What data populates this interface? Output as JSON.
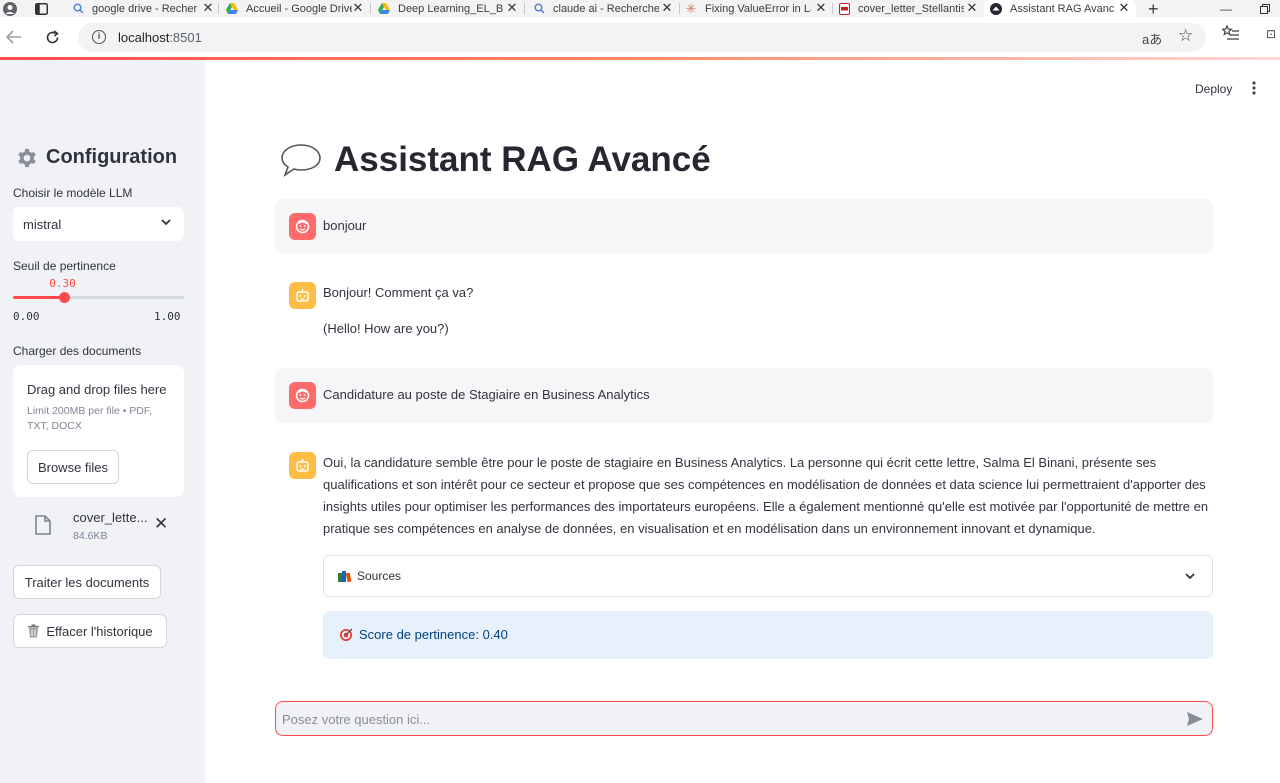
{
  "browser": {
    "tabs": [
      {
        "label": "google drive - Recher",
        "icon": "search-icon"
      },
      {
        "label": "Accueil - Google Drive",
        "icon": "google-drive-icon"
      },
      {
        "label": "Deep Learning_EL_BIN",
        "icon": "google-drive-icon"
      },
      {
        "label": "claude ai - Recherche",
        "icon": "search-icon"
      },
      {
        "label": "Fixing ValueError in La",
        "icon": "claude-icon"
      },
      {
        "label": "cover_letter_Stellantis",
        "icon": "pdf-icon"
      },
      {
        "label": "Assistant RAG Avancé",
        "icon": "streamlit-icon",
        "active": true
      }
    ],
    "url": {
      "host": "localhost",
      "port": ":8501"
    }
  },
  "sidebar": {
    "title": "Configuration",
    "model": {
      "label": "Choisir le modèle LLM",
      "value": "mistral"
    },
    "threshold": {
      "label": "Seuil de pertinence",
      "value": 0.3,
      "value_text": "0.30",
      "min_text": "0.00",
      "max_text": "1.00"
    },
    "uploader": {
      "label": "Charger des documents",
      "drag_text": "Drag and drop files here",
      "limit_text": "Limit 200MB per file • PDF, TXT, DOCX",
      "browse_label": "Browse files"
    },
    "file": {
      "name": "cover_lette...",
      "size": "84.6KB"
    },
    "process_label": "Traiter les documents",
    "clear_label": "Effacer l'historique"
  },
  "header": {
    "deploy_label": "Deploy"
  },
  "main": {
    "title": "Assistant RAG Avancé",
    "messages": [
      {
        "role": "user",
        "text": "bonjour"
      },
      {
        "role": "assistant",
        "lines": [
          "Bonjour! Comment ça va?",
          "(Hello! How are you?)"
        ]
      },
      {
        "role": "user",
        "text": "Candidature au poste de Stagiaire en Business Analytics"
      },
      {
        "role": "assistant",
        "text": "Oui, la candidature semble être pour le poste de stagiaire en Business Analytics. La personne qui écrit cette lettre, Salma El Binani, présente ses qualifications et son intérêt pour ce secteur et propose que ses compétences en modélisation de données et data science lui permettraient d'apporter des insights utiles pour optimiser les performances des importateurs européens. Elle a également mentionné qu'elle est motivée par l'opportunité de mettre en pratique ses compétences en analyse de données, en visualisation et en modélisation dans un environnement innovant et dynamique."
      }
    ],
    "sources_label": "Sources",
    "score_text": "Score de pertinence: 0.40",
    "input_placeholder": "Posez votre question ici..."
  },
  "colors": {
    "accent": "#ff4b4b",
    "sidebar_bg": "#f0f2f6",
    "user_avatar": "#ff6a6a",
    "bot_avatar": "#ffbd45",
    "info_bg": "#e8f0fb"
  }
}
